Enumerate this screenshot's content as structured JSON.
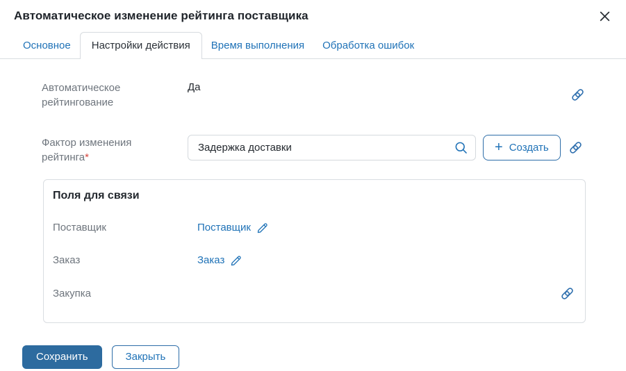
{
  "dialog": {
    "title": "Автоматическое изменение рейтинга поставщика"
  },
  "tabs": [
    {
      "label": "Основное",
      "active": false
    },
    {
      "label": "Настройки действия",
      "active": true
    },
    {
      "label": "Время выполнения",
      "active": false
    },
    {
      "label": "Обработка ошибок",
      "active": false
    }
  ],
  "fields": {
    "auto_rating": {
      "label": "Автоматическое рейтингование",
      "value": "Да"
    },
    "factor": {
      "label": "Фактор изменения рейтинга",
      "required_mark": "*",
      "input_value": "Задержка доставки",
      "plus": "+",
      "create_button": "Создать"
    }
  },
  "relation_box": {
    "title": "Поля для связи",
    "rows": [
      {
        "label": "Поставщик",
        "link": "Поставщик"
      },
      {
        "label": "Заказ",
        "link": "Заказ"
      },
      {
        "label": "Закупка",
        "link": ""
      }
    ]
  },
  "footer": {
    "save": "Сохранить",
    "close": "Закрыть"
  },
  "colors": {
    "accent_blue": "#1f72b7",
    "icon_blue": "#2e6fae",
    "primary_button": "#2d6b9f",
    "label_gray": "#6e757d",
    "required_red": "#d6453d",
    "border_gray": "#d9dde1"
  }
}
